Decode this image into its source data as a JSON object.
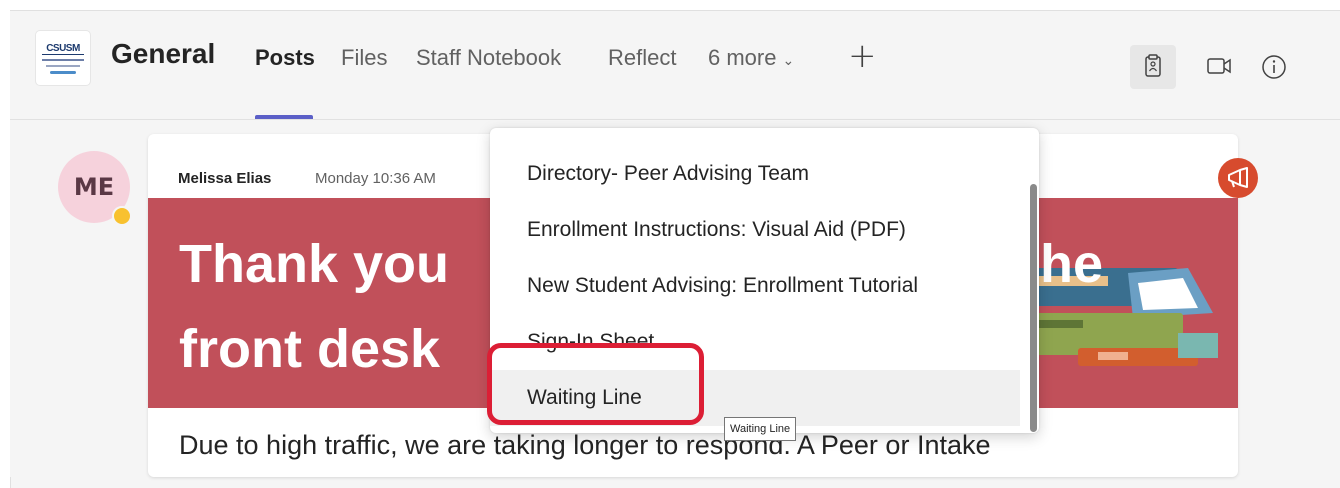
{
  "team": {
    "logo_text": "CSUSM"
  },
  "channel": {
    "name": "General"
  },
  "tabs": [
    {
      "label": "Posts",
      "active": true
    },
    {
      "label": "Files"
    },
    {
      "label": "Staff Notebook"
    },
    {
      "label": "Reflect"
    },
    {
      "label": "6 more"
    }
  ],
  "header_icons": [
    "add-tab-icon",
    "clipboard-icon",
    "video-icon",
    "info-icon"
  ],
  "post": {
    "avatar_initials": "ME",
    "author": "Melissa Elias",
    "time": "Monday 10:36 AM",
    "banner_line1": "Thank you",
    "banner_line1_tail": "he",
    "banner_line2": "front desk",
    "body": "Due to high traffic, we are taking longer to respond. A Peer or Intake"
  },
  "menu": {
    "items": [
      "Directory- Peer Advising Team",
      "Enrollment Instructions: Visual Aid (PDF)",
      "New Student Advising: Enrollment Tutorial",
      "Sign-In Sheet",
      "Waiting Line"
    ],
    "hovered_index": 4
  },
  "tooltip": {
    "text": "Waiting Line"
  },
  "colors": {
    "accent": "#5b5fc7",
    "banner": "#c1505a",
    "highlight": "#dc1e35",
    "announcement": "#d74b2e"
  }
}
